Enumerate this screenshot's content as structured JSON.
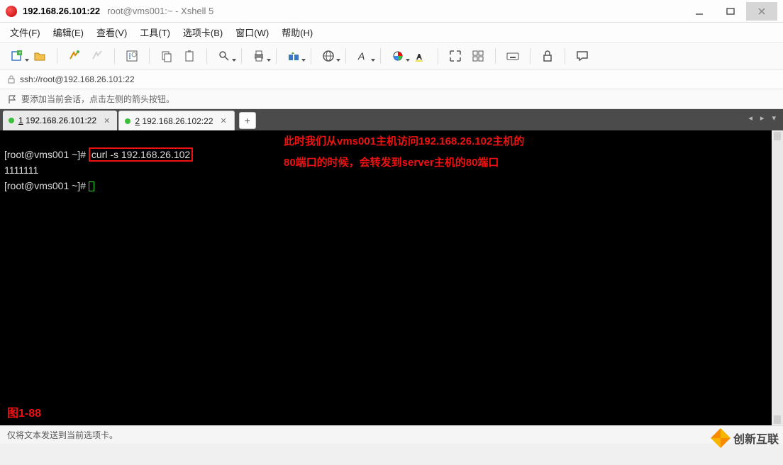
{
  "window": {
    "title": "192.168.26.101:22",
    "subtitle": "root@vms001:~ - Xshell 5"
  },
  "menu": {
    "file": "文件(F)",
    "edit": "编辑(E)",
    "view": "查看(V)",
    "tools": "工具(T)",
    "tabs": "选项卡(B)",
    "window": "窗口(W)",
    "help": "帮助(H)"
  },
  "address": "ssh://root@192.168.26.101:22",
  "hint": "要添加当前会话，点击左侧的箭头按钮。",
  "tabs": [
    {
      "num": "1",
      "label": "192.168.26.101:22",
      "active": true
    },
    {
      "num": "2",
      "label": "192.168.26.102:22",
      "active": false
    }
  ],
  "terminal": {
    "prompt1": "[root@vms001 ~]# ",
    "cmd": "curl -s 192.168.26.102",
    "output": "1111111",
    "prompt2": "[root@vms001 ~]# ",
    "annotation1": "此时我们从vms001主机访问192.168.26.102主机的",
    "annotation2": "80端口的时候，会转发到server主机的80端口",
    "figure": "图1-88"
  },
  "status": "仅将文本发送到当前选项卡。",
  "watermark": "创新互联"
}
